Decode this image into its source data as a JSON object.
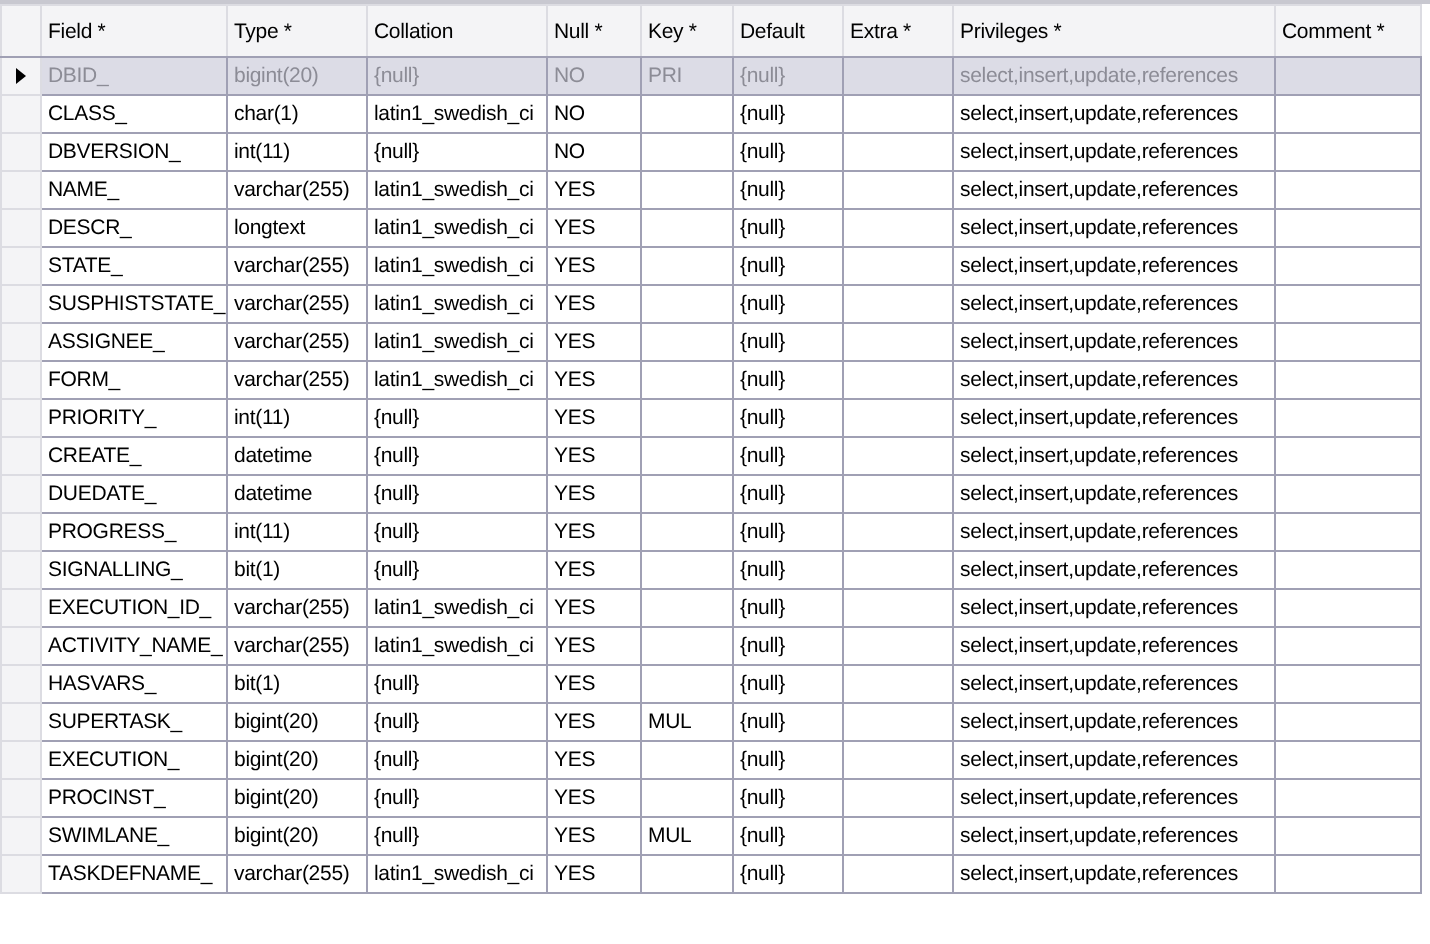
{
  "columns": [
    "Field *",
    "Type *",
    "Collation",
    "Null *",
    "Key *",
    "Default",
    "Extra *",
    "Privileges *",
    "Comment *"
  ],
  "rows": [
    {
      "selected": true,
      "cells": [
        "DBID_",
        "bigint(20)",
        "{null}",
        "NO",
        "PRI",
        "{null}",
        "",
        "select,insert,update,references",
        ""
      ]
    },
    {
      "selected": false,
      "cells": [
        "CLASS_",
        "char(1)",
        "latin1_swedish_ci",
        "NO",
        "",
        "{null}",
        "",
        "select,insert,update,references",
        ""
      ]
    },
    {
      "selected": false,
      "cells": [
        "DBVERSION_",
        "int(11)",
        "{null}",
        "NO",
        "",
        "{null}",
        "",
        "select,insert,update,references",
        ""
      ]
    },
    {
      "selected": false,
      "cells": [
        "NAME_",
        "varchar(255)",
        "latin1_swedish_ci",
        "YES",
        "",
        "{null}",
        "",
        "select,insert,update,references",
        ""
      ]
    },
    {
      "selected": false,
      "cells": [
        "DESCR_",
        "longtext",
        "latin1_swedish_ci",
        "YES",
        "",
        "{null}",
        "",
        "select,insert,update,references",
        ""
      ]
    },
    {
      "selected": false,
      "cells": [
        "STATE_",
        "varchar(255)",
        "latin1_swedish_ci",
        "YES",
        "",
        "{null}",
        "",
        "select,insert,update,references",
        ""
      ]
    },
    {
      "selected": false,
      "cells": [
        "SUSPHISTSTATE_",
        "varchar(255)",
        "latin1_swedish_ci",
        "YES",
        "",
        "{null}",
        "",
        "select,insert,update,references",
        ""
      ]
    },
    {
      "selected": false,
      "cells": [
        "ASSIGNEE_",
        "varchar(255)",
        "latin1_swedish_ci",
        "YES",
        "",
        "{null}",
        "",
        "select,insert,update,references",
        ""
      ]
    },
    {
      "selected": false,
      "cells": [
        "FORM_",
        "varchar(255)",
        "latin1_swedish_ci",
        "YES",
        "",
        "{null}",
        "",
        "select,insert,update,references",
        ""
      ]
    },
    {
      "selected": false,
      "cells": [
        "PRIORITY_",
        "int(11)",
        "{null}",
        "YES",
        "",
        "{null}",
        "",
        "select,insert,update,references",
        ""
      ]
    },
    {
      "selected": false,
      "cells": [
        "CREATE_",
        "datetime",
        "{null}",
        "YES",
        "",
        "{null}",
        "",
        "select,insert,update,references",
        ""
      ]
    },
    {
      "selected": false,
      "cells": [
        "DUEDATE_",
        "datetime",
        "{null}",
        "YES",
        "",
        "{null}",
        "",
        "select,insert,update,references",
        ""
      ]
    },
    {
      "selected": false,
      "cells": [
        "PROGRESS_",
        "int(11)",
        "{null}",
        "YES",
        "",
        "{null}",
        "",
        "select,insert,update,references",
        ""
      ]
    },
    {
      "selected": false,
      "cells": [
        "SIGNALLING_",
        "bit(1)",
        "{null}",
        "YES",
        "",
        "{null}",
        "",
        "select,insert,update,references",
        ""
      ]
    },
    {
      "selected": false,
      "cells": [
        "EXECUTION_ID_",
        "varchar(255)",
        "latin1_swedish_ci",
        "YES",
        "",
        "{null}",
        "",
        "select,insert,update,references",
        ""
      ]
    },
    {
      "selected": false,
      "cells": [
        "ACTIVITY_NAME_",
        "varchar(255)",
        "latin1_swedish_ci",
        "YES",
        "",
        "{null}",
        "",
        "select,insert,update,references",
        ""
      ]
    },
    {
      "selected": false,
      "cells": [
        "HASVARS_",
        "bit(1)",
        "{null}",
        "YES",
        "",
        "{null}",
        "",
        "select,insert,update,references",
        ""
      ]
    },
    {
      "selected": false,
      "cells": [
        "SUPERTASK_",
        "bigint(20)",
        "{null}",
        "YES",
        "MUL",
        "{null}",
        "",
        "select,insert,update,references",
        ""
      ]
    },
    {
      "selected": false,
      "cells": [
        "EXECUTION_",
        "bigint(20)",
        "{null}",
        "YES",
        "",
        "{null}",
        "",
        "select,insert,update,references",
        ""
      ]
    },
    {
      "selected": false,
      "cells": [
        "PROCINST_",
        "bigint(20)",
        "{null}",
        "YES",
        "",
        "{null}",
        "",
        "select,insert,update,references",
        ""
      ]
    },
    {
      "selected": false,
      "cells": [
        "SWIMLANE_",
        "bigint(20)",
        "{null}",
        "YES",
        "MUL",
        "{null}",
        "",
        "select,insert,update,references",
        ""
      ]
    },
    {
      "selected": false,
      "cells": [
        "TASKDEFNAME_",
        "varchar(255)",
        "latin1_swedish_ci",
        "YES",
        "",
        "{null}",
        "",
        "select,insert,update,references",
        ""
      ]
    }
  ]
}
